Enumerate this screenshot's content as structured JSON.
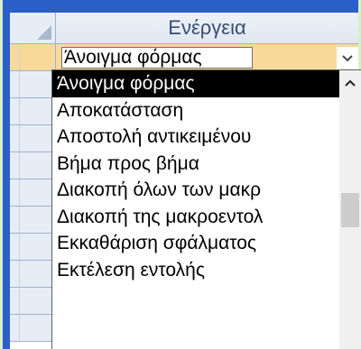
{
  "header": {
    "column_title": "Ενέργεια"
  },
  "combo": {
    "value": "Άνοιγμα φόρμας"
  },
  "icons": {
    "combo_arrow": "chevron-down-icon",
    "scroll_up": "chevron-up-icon"
  },
  "dropdown": {
    "items": [
      "Άνοιγμα φόρμας",
      "Αποκατάσταση",
      "Αποστολή αντικειμένου",
      "Βήμα προς βήμα",
      "Διακοπή όλων των μακρ",
      "Διακοπή της μακροεντολ",
      "Εκκαθάριση σφάλματος",
      "Εκτέλεση εντολής"
    ],
    "selected_index": 0
  },
  "colors": {
    "frame": "#2a5ec8",
    "background": "#d8eec9",
    "active_row": "#f9d99a",
    "selection": "#000000"
  }
}
